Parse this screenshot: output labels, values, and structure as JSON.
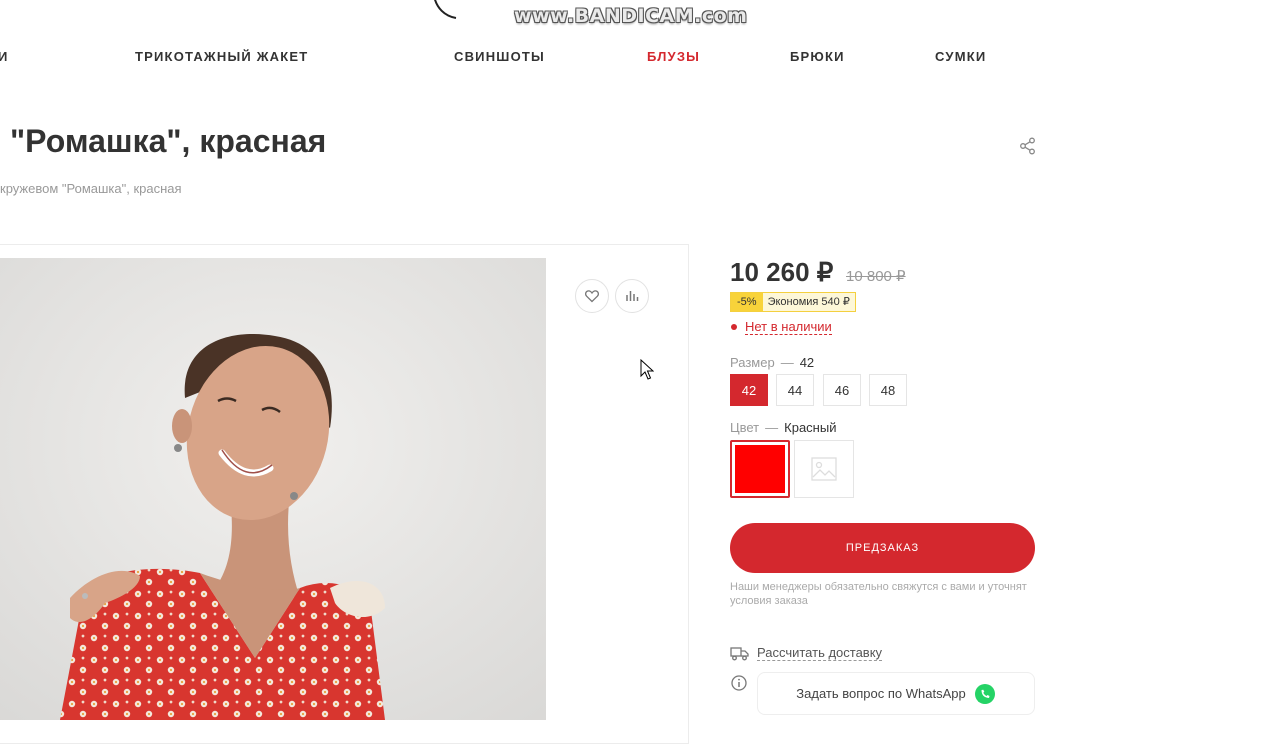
{
  "watermark": "www.BANDICAM.com",
  "nav": {
    "items": [
      {
        "label": "И",
        "active": false
      },
      {
        "label": "ТРИКОТАЖНЫЙ ЖАКЕТ",
        "active": false
      },
      {
        "label": "СВИНШОТЫ",
        "active": false
      },
      {
        "label": "БЛУЗЫ",
        "active": true
      },
      {
        "label": "БРЮКИ",
        "active": false
      },
      {
        "label": "СУМКИ",
        "active": false
      }
    ]
  },
  "product": {
    "title": "\"Ромашка\", красная",
    "breadcrumb": "кружевом \"Ромашка\", красная"
  },
  "gallery": {
    "favorite_icon": "heart-icon",
    "compare_icon": "bar-chart-icon"
  },
  "price": {
    "current": "10 260 ₽",
    "old": "10 800 ₽",
    "discount": "-5%",
    "savings": "Экономия 540 ₽"
  },
  "stock": {
    "status": "Нет в наличии"
  },
  "size": {
    "label": "Размер",
    "separator": "—",
    "selected": "42",
    "options": [
      "42",
      "44",
      "46",
      "48"
    ]
  },
  "color": {
    "label": "Цвет",
    "separator": "—",
    "selected": "Красный",
    "swatch_hex": "#ff0000"
  },
  "actions": {
    "preorder": "ПРЕДЗАКАЗ",
    "note": "Наши менеджеры обязательно свяжутся с вами и уточнят условия заказа",
    "delivery": "Рассчитать доставку",
    "whatsapp": "Задать вопрос по WhatsApp"
  },
  "colors": {
    "accent": "#d4282e",
    "whatsapp": "#25d366",
    "badge": "#f8d33a"
  }
}
